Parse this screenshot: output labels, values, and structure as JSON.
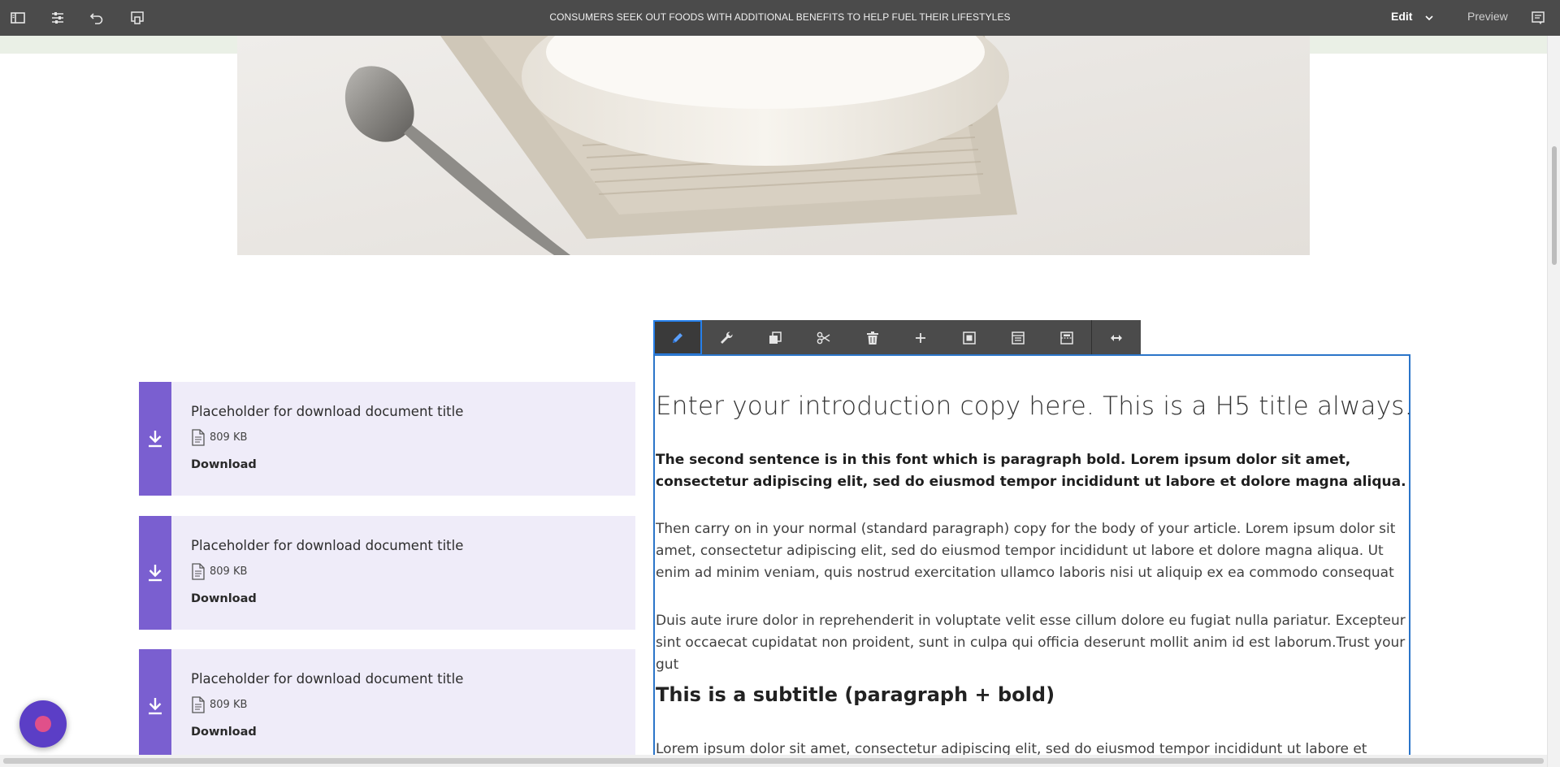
{
  "topbar": {
    "title": "CONSUMERS SEEK OUT FOODS WITH ADDITIONAL BENEFITS TO HELP FUEL THEIR LIFESTYLES",
    "mode_label": "Edit",
    "preview_label": "Preview",
    "icons": [
      "side-panel-icon",
      "properties-icon",
      "undo-icon",
      "emulator-icon",
      "annotations-icon"
    ]
  },
  "downloads": [
    {
      "title": "Placeholder for download document title",
      "size": "809 KB",
      "link": "Download"
    },
    {
      "title": "Placeholder for download document title",
      "size": "809 KB",
      "link": "Download"
    },
    {
      "title": "Placeholder for download document title",
      "size": "809 KB",
      "link": "Download"
    }
  ],
  "component_toolbar": {
    "buttons": [
      "edit-icon",
      "configure-icon",
      "copy-icon",
      "cut-icon",
      "delete-icon",
      "insert-icon",
      "parent-icon",
      "group-icon",
      "layout-icon",
      "resize-icon"
    ]
  },
  "text_component": {
    "h5": "Enter your introduction copy here. This is a H5 title always.",
    "bold_paragraph": "The second sentence is in this font which is paragraph bold. Lorem ipsum dolor sit amet, consectetur adipiscing elit, sed do eiusmod tempor incididunt ut labore et dolore magna aliqua.",
    "paragraph_1": "Then carry on in your normal (standard paragraph) copy for the body of your article.  Lorem ipsum dolor sit amet, consectetur adipiscing elit, sed do eiusmod tempor incididunt ut labore et dolore magna aliqua. Ut enim ad minim veniam, quis nostrud exercitation ullamco laboris nisi ut aliquip ex ea commodo consequat",
    "paragraph_2": "Duis aute irure dolor in reprehenderit in voluptate velit esse cillum dolore eu fugiat nulla pariatur. Excepteur sint occaecat cupidatat non proident, sunt in culpa qui officia deserunt mollit anim id est laborum.Trust your gut",
    "subtitle": "This is a subtitle (paragraph + bold)",
    "paragraph_3": "Lorem ipsum dolor sit amet, consectetur adipiscing elit, sed do eiusmod tempor incididunt ut labore et dolore"
  },
  "colors": {
    "topbar": "#4b4b4b",
    "download_accent": "#7a5fd0",
    "download_bg": "#efecf9",
    "selection_border": "#2b75c9",
    "fab": "#5b3ec6"
  }
}
